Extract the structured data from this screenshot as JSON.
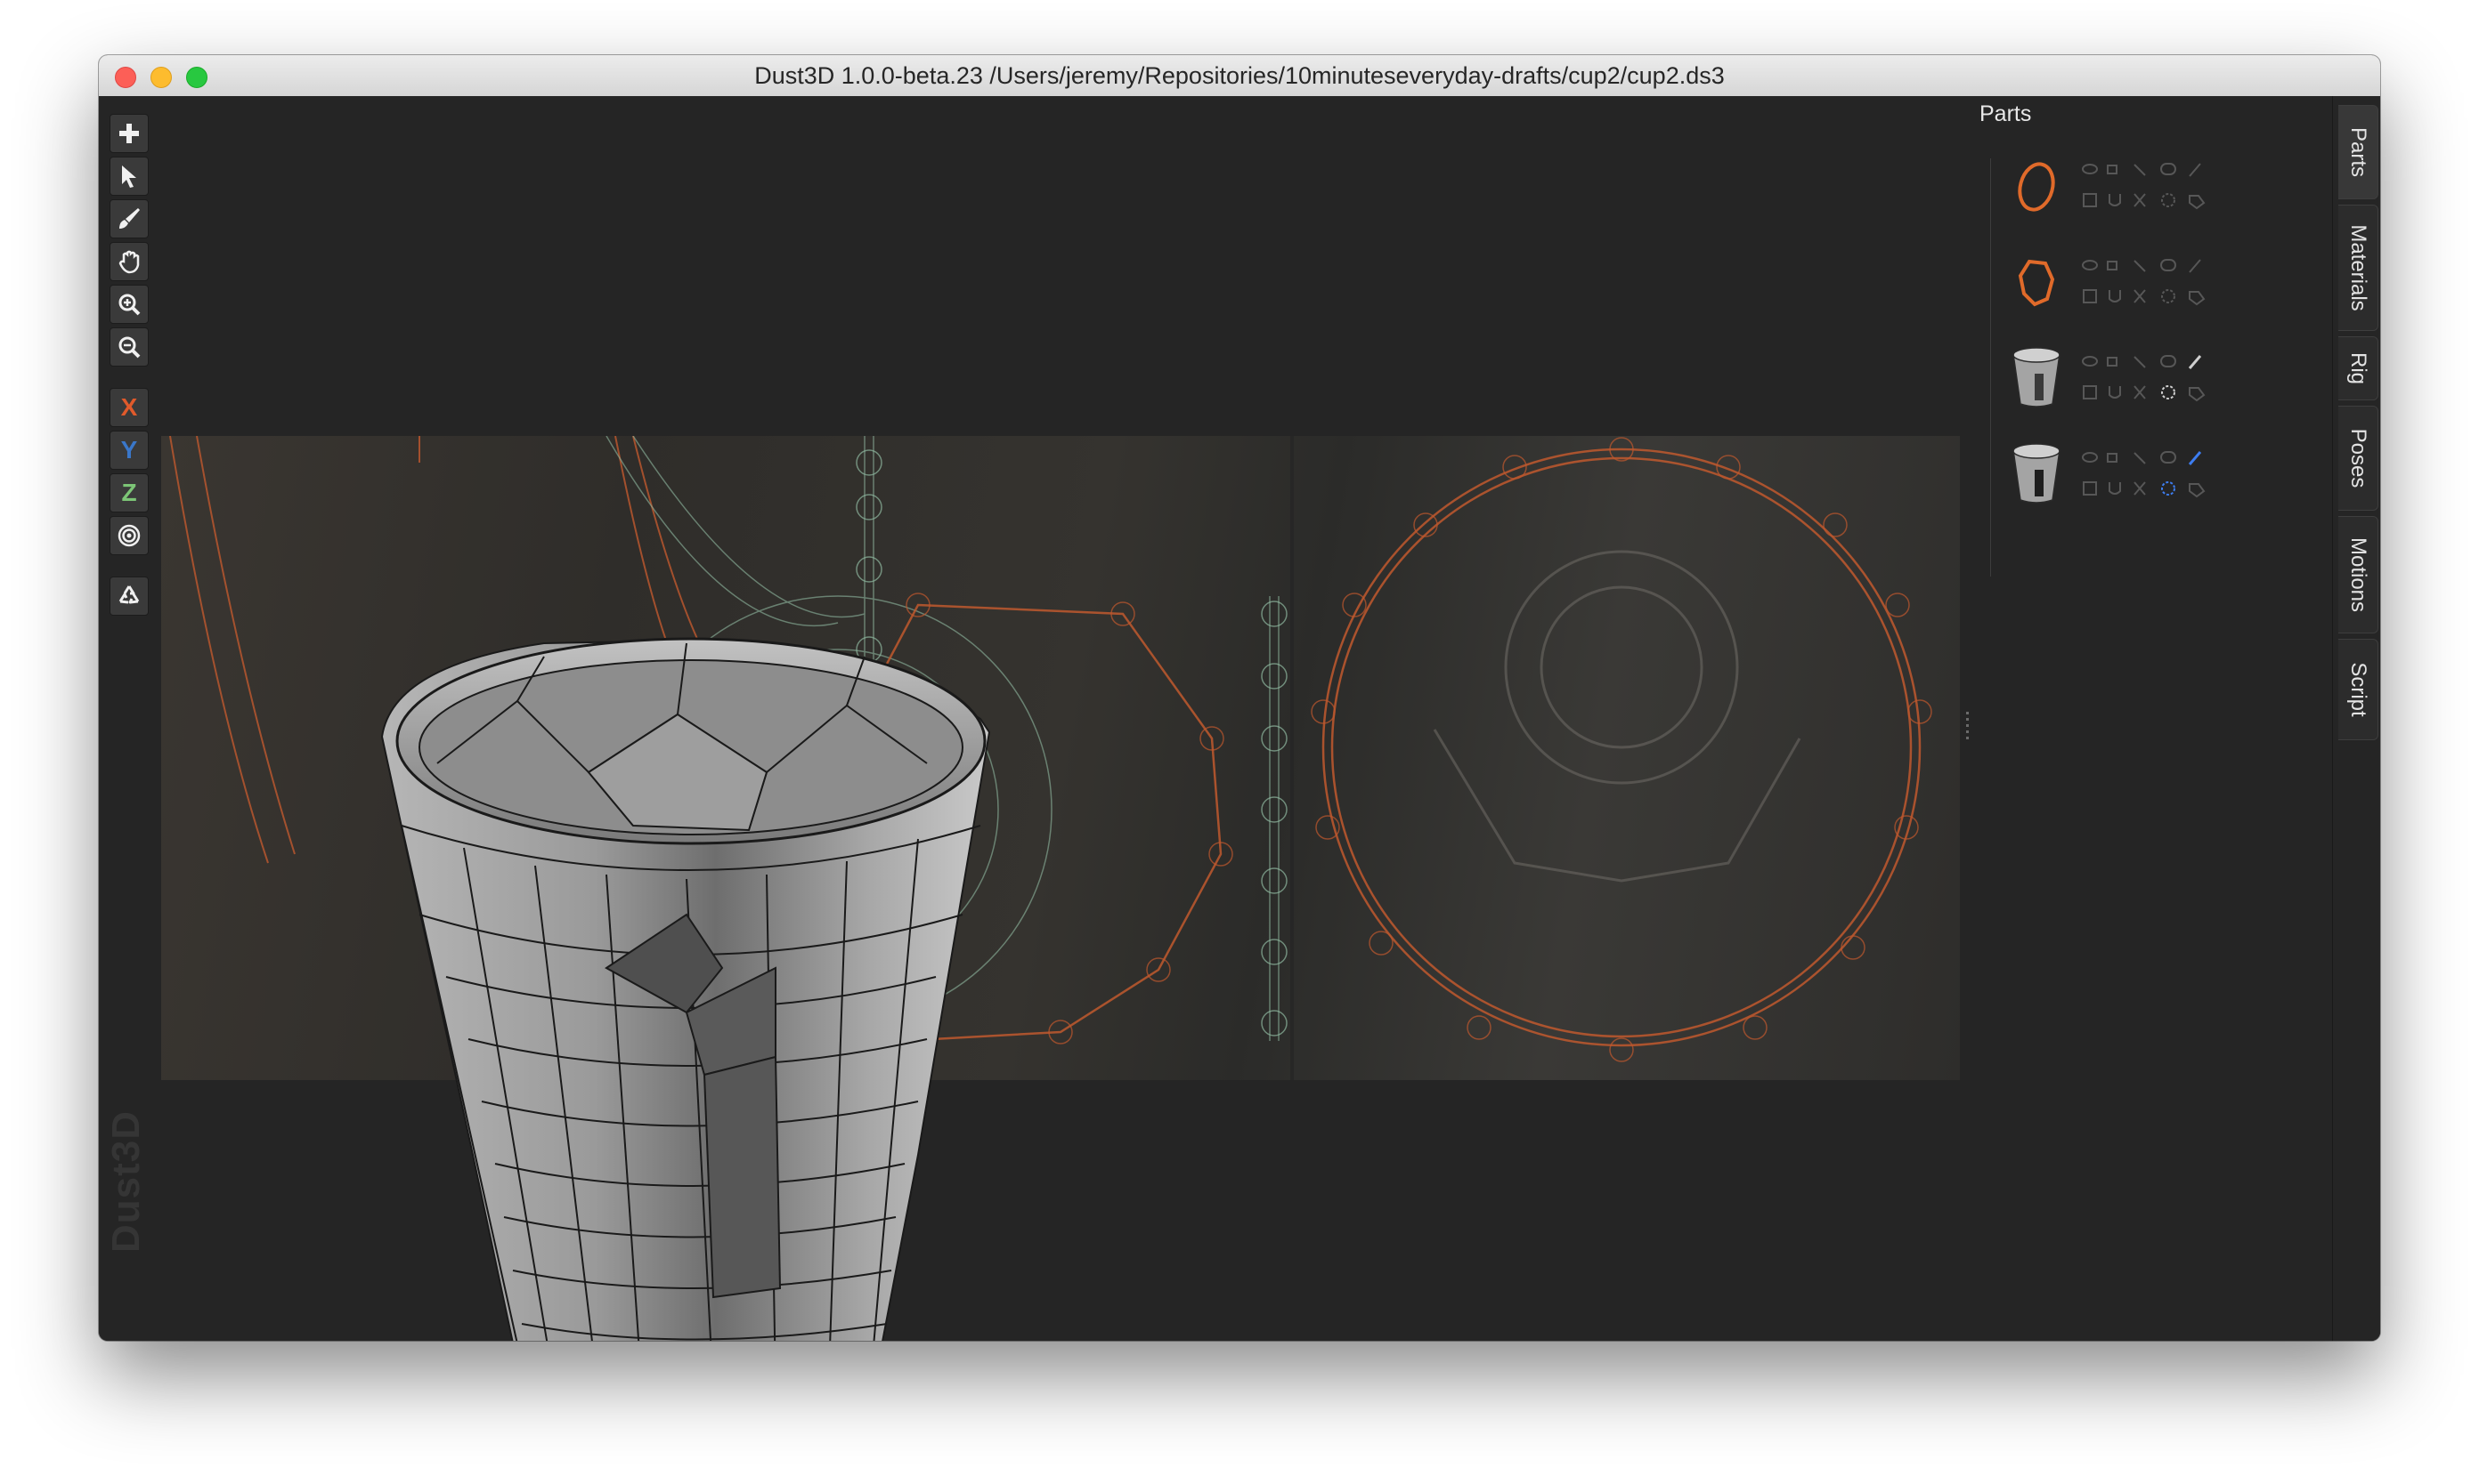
{
  "window": {
    "title": "Dust3D 1.0.0-beta.23 /Users/jeremy/Repositories/10minuteseveryday-drafts/cup2/cup2.ds3"
  },
  "toolbar": {
    "tools": [
      {
        "name": "add",
        "icon": "plus-icon"
      },
      {
        "name": "select",
        "icon": "pointer-arrow-icon"
      },
      {
        "name": "paint",
        "icon": "paintbrush-icon"
      },
      {
        "name": "drag",
        "icon": "hand-icon"
      },
      {
        "name": "zoom-in",
        "icon": "zoom-in-icon"
      },
      {
        "name": "zoom-out",
        "icon": "zoom-out-icon"
      }
    ],
    "axis_x": "X",
    "axis_y": "Y",
    "axis_z": "Z",
    "radial_icon": "target-icon",
    "regenerate_icon": "recycle-icon"
  },
  "watermark": "Dust3D",
  "parts_panel": {
    "title": "Parts",
    "float_icon": "float-window-icon",
    "close_icon": "close-icon",
    "parts": [
      {
        "thumb": "orange-ring",
        "icons": [
          "eye-icon",
          "lock-icon",
          "link-icon",
          "brain-icon",
          "pencil-icon",
          "square-icon",
          "magnet-icon",
          "scissors-icon",
          "circle-dash-icon",
          "tag-icon"
        ]
      },
      {
        "thumb": "orange-octagon",
        "icons": [
          "eye-icon",
          "lock-icon",
          "link-icon",
          "brain-icon",
          "pencil-icon",
          "square-icon",
          "magnet-icon",
          "scissors-icon",
          "circle-dash-icon",
          "tag-icon"
        ]
      },
      {
        "thumb": "grey-cup",
        "icons": [
          "eye-icon",
          "lock-icon",
          "link-icon",
          "brain-icon",
          "pencil-icon",
          "square-icon",
          "magnet-icon",
          "scissors-icon",
          "circle-dash-icon",
          "tag-icon"
        ]
      },
      {
        "thumb": "grey-cup",
        "icons": [
          "eye-icon",
          "lock-icon",
          "link-icon",
          "brain-icon",
          "pencil-icon",
          "square-icon",
          "magnet-icon",
          "scissors-icon",
          "circle-dash-icon",
          "tag-icon"
        ]
      }
    ]
  },
  "side_tabs": [
    "Parts",
    "Materials",
    "Rig",
    "Poses",
    "Motions",
    "Script"
  ],
  "colors": {
    "background": "#252525",
    "axis_x": "#e05a2b",
    "axis_y": "#3a77c9",
    "axis_z": "#7cc576",
    "profile_lines": "#c0592e",
    "guide_lines": "#8fb8a0",
    "selected_icon": "#3d7df0"
  }
}
